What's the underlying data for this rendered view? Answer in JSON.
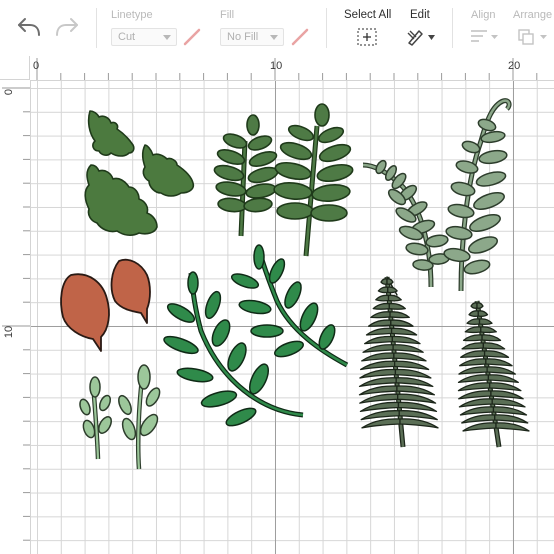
{
  "toolbar": {
    "undo_icon": "undo-arrow-icon",
    "redo_icon": "redo-arrow-icon",
    "linetype": {
      "label": "Linetype",
      "value": "Cut"
    },
    "fill": {
      "label": "Fill",
      "value": "No Fill"
    },
    "select_all": {
      "label": "Select All",
      "icon": "select-all-icon"
    },
    "edit": {
      "label": "Edit",
      "icon": "edit-pencil-icon"
    },
    "align": {
      "label": "Align",
      "icon": "align-icon"
    },
    "arrange": {
      "label": "Arrange",
      "icon": "arrange-icon"
    }
  },
  "ruler": {
    "top_labels": [
      "0",
      "10",
      "20"
    ],
    "left_labels": [
      "0",
      "10"
    ]
  },
  "canvas": {
    "shapes": [
      {
        "name": "dark-green-leaf",
        "color": "#4c7a3f",
        "count": 4
      },
      {
        "name": "green-stem-leaf",
        "color": "#4e7a45",
        "count": 2
      },
      {
        "name": "grey-green-fern-frond",
        "color": "#8ca88a",
        "count": 2
      },
      {
        "name": "rust-leaf",
        "color": "#c06448",
        "count": 2
      },
      {
        "name": "bright-green-sprig",
        "color": "#2f8a4a",
        "count": 2
      },
      {
        "name": "light-green-sprig",
        "color": "#9cc79a",
        "count": 2
      },
      {
        "name": "dark-fern",
        "color": "#5b6f56",
        "count": 2
      }
    ]
  }
}
